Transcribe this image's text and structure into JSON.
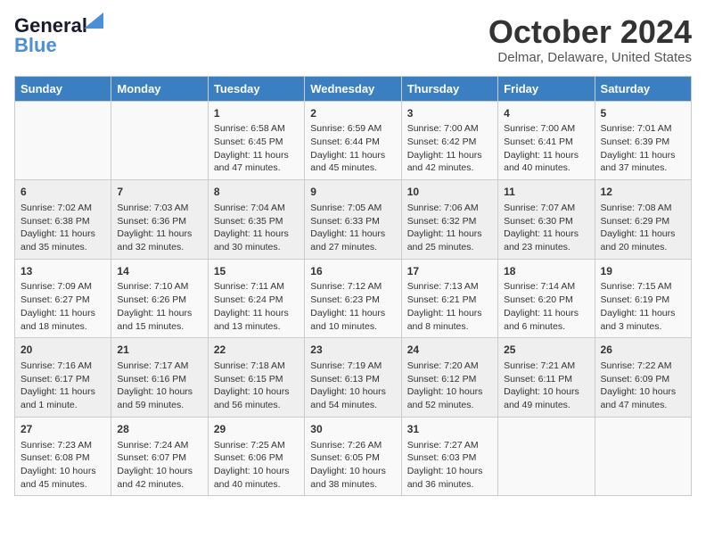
{
  "header": {
    "logo_line1": "General",
    "logo_line2": "Blue",
    "month": "October 2024",
    "location": "Delmar, Delaware, United States"
  },
  "days_of_week": [
    "Sunday",
    "Monday",
    "Tuesday",
    "Wednesday",
    "Thursday",
    "Friday",
    "Saturday"
  ],
  "weeks": [
    [
      {
        "num": "",
        "info": ""
      },
      {
        "num": "",
        "info": ""
      },
      {
        "num": "1",
        "info": "Sunrise: 6:58 AM\nSunset: 6:45 PM\nDaylight: 11 hours and 47 minutes."
      },
      {
        "num": "2",
        "info": "Sunrise: 6:59 AM\nSunset: 6:44 PM\nDaylight: 11 hours and 45 minutes."
      },
      {
        "num": "3",
        "info": "Sunrise: 7:00 AM\nSunset: 6:42 PM\nDaylight: 11 hours and 42 minutes."
      },
      {
        "num": "4",
        "info": "Sunrise: 7:00 AM\nSunset: 6:41 PM\nDaylight: 11 hours and 40 minutes."
      },
      {
        "num": "5",
        "info": "Sunrise: 7:01 AM\nSunset: 6:39 PM\nDaylight: 11 hours and 37 minutes."
      }
    ],
    [
      {
        "num": "6",
        "info": "Sunrise: 7:02 AM\nSunset: 6:38 PM\nDaylight: 11 hours and 35 minutes."
      },
      {
        "num": "7",
        "info": "Sunrise: 7:03 AM\nSunset: 6:36 PM\nDaylight: 11 hours and 32 minutes."
      },
      {
        "num": "8",
        "info": "Sunrise: 7:04 AM\nSunset: 6:35 PM\nDaylight: 11 hours and 30 minutes."
      },
      {
        "num": "9",
        "info": "Sunrise: 7:05 AM\nSunset: 6:33 PM\nDaylight: 11 hours and 27 minutes."
      },
      {
        "num": "10",
        "info": "Sunrise: 7:06 AM\nSunset: 6:32 PM\nDaylight: 11 hours and 25 minutes."
      },
      {
        "num": "11",
        "info": "Sunrise: 7:07 AM\nSunset: 6:30 PM\nDaylight: 11 hours and 23 minutes."
      },
      {
        "num": "12",
        "info": "Sunrise: 7:08 AM\nSunset: 6:29 PM\nDaylight: 11 hours and 20 minutes."
      }
    ],
    [
      {
        "num": "13",
        "info": "Sunrise: 7:09 AM\nSunset: 6:27 PM\nDaylight: 11 hours and 18 minutes."
      },
      {
        "num": "14",
        "info": "Sunrise: 7:10 AM\nSunset: 6:26 PM\nDaylight: 11 hours and 15 minutes."
      },
      {
        "num": "15",
        "info": "Sunrise: 7:11 AM\nSunset: 6:24 PM\nDaylight: 11 hours and 13 minutes."
      },
      {
        "num": "16",
        "info": "Sunrise: 7:12 AM\nSunset: 6:23 PM\nDaylight: 11 hours and 10 minutes."
      },
      {
        "num": "17",
        "info": "Sunrise: 7:13 AM\nSunset: 6:21 PM\nDaylight: 11 hours and 8 minutes."
      },
      {
        "num": "18",
        "info": "Sunrise: 7:14 AM\nSunset: 6:20 PM\nDaylight: 11 hours and 6 minutes."
      },
      {
        "num": "19",
        "info": "Sunrise: 7:15 AM\nSunset: 6:19 PM\nDaylight: 11 hours and 3 minutes."
      }
    ],
    [
      {
        "num": "20",
        "info": "Sunrise: 7:16 AM\nSunset: 6:17 PM\nDaylight: 11 hours and 1 minute."
      },
      {
        "num": "21",
        "info": "Sunrise: 7:17 AM\nSunset: 6:16 PM\nDaylight: 10 hours and 59 minutes."
      },
      {
        "num": "22",
        "info": "Sunrise: 7:18 AM\nSunset: 6:15 PM\nDaylight: 10 hours and 56 minutes."
      },
      {
        "num": "23",
        "info": "Sunrise: 7:19 AM\nSunset: 6:13 PM\nDaylight: 10 hours and 54 minutes."
      },
      {
        "num": "24",
        "info": "Sunrise: 7:20 AM\nSunset: 6:12 PM\nDaylight: 10 hours and 52 minutes."
      },
      {
        "num": "25",
        "info": "Sunrise: 7:21 AM\nSunset: 6:11 PM\nDaylight: 10 hours and 49 minutes."
      },
      {
        "num": "26",
        "info": "Sunrise: 7:22 AM\nSunset: 6:09 PM\nDaylight: 10 hours and 47 minutes."
      }
    ],
    [
      {
        "num": "27",
        "info": "Sunrise: 7:23 AM\nSunset: 6:08 PM\nDaylight: 10 hours and 45 minutes."
      },
      {
        "num": "28",
        "info": "Sunrise: 7:24 AM\nSunset: 6:07 PM\nDaylight: 10 hours and 42 minutes."
      },
      {
        "num": "29",
        "info": "Sunrise: 7:25 AM\nSunset: 6:06 PM\nDaylight: 10 hours and 40 minutes."
      },
      {
        "num": "30",
        "info": "Sunrise: 7:26 AM\nSunset: 6:05 PM\nDaylight: 10 hours and 38 minutes."
      },
      {
        "num": "31",
        "info": "Sunrise: 7:27 AM\nSunset: 6:03 PM\nDaylight: 10 hours and 36 minutes."
      },
      {
        "num": "",
        "info": ""
      },
      {
        "num": "",
        "info": ""
      }
    ]
  ]
}
